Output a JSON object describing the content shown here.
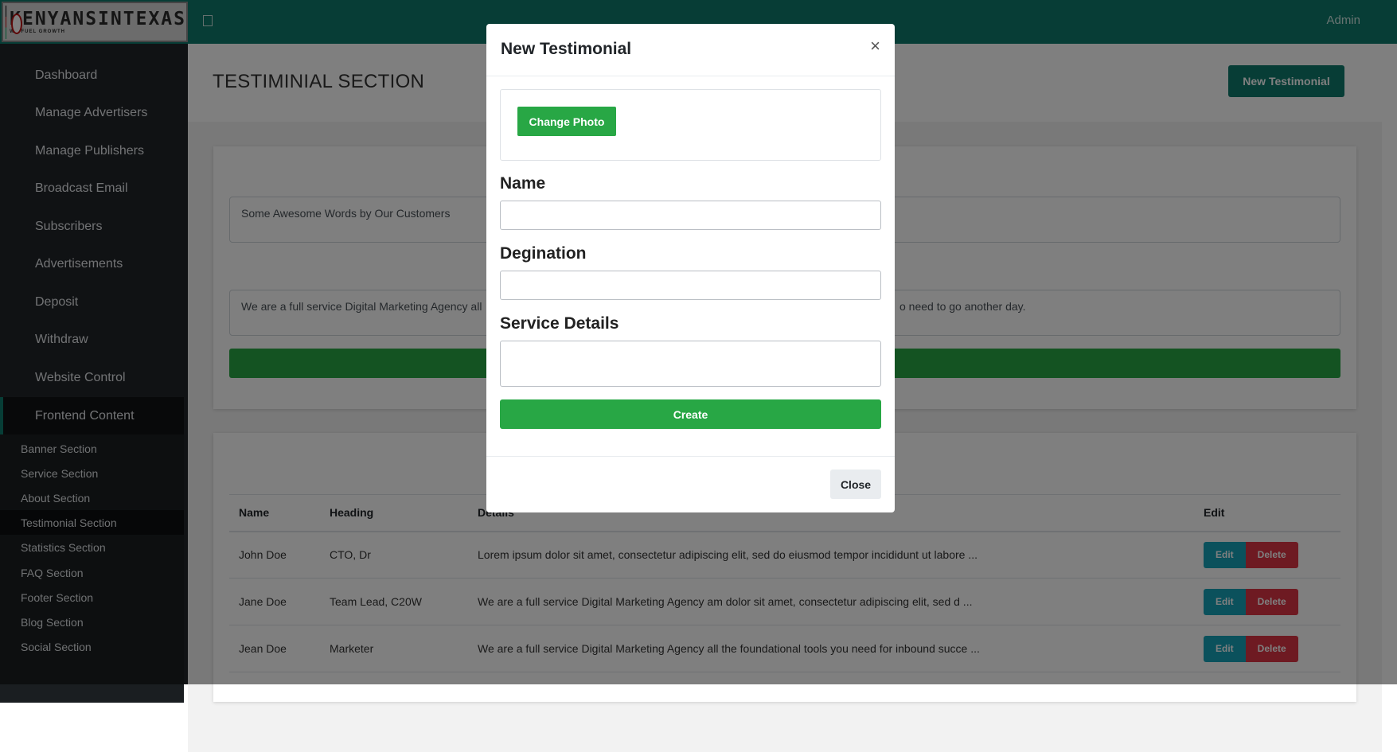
{
  "topbar": {
    "logo_text": "KENYANSINTEXAS",
    "logo_tagline": "WE FUEL GROWTH",
    "user": "Admin"
  },
  "sidebar": {
    "items": [
      {
        "label": "Dashboard"
      },
      {
        "label": "Manage Advertisers"
      },
      {
        "label": "Manage Publishers"
      },
      {
        "label": "Broadcast Email"
      },
      {
        "label": "Subscribers"
      },
      {
        "label": "Advertisements"
      },
      {
        "label": "Deposit"
      },
      {
        "label": "Withdraw"
      },
      {
        "label": "Website Control"
      },
      {
        "label": "Frontend Content"
      }
    ],
    "sub_items": [
      {
        "label": "Banner Section"
      },
      {
        "label": "Service Section"
      },
      {
        "label": "About Section"
      },
      {
        "label": "Testimonial Section"
      },
      {
        "label": "Statistics Section"
      },
      {
        "label": "FAQ Section"
      },
      {
        "label": "Footer Section"
      },
      {
        "label": "Blog Section"
      },
      {
        "label": "Social Section"
      }
    ]
  },
  "main": {
    "title": "TESTIMINIAL SECTION",
    "new_button": "New Testimonial",
    "heading_value": "Some Awesome Words by Our Customers",
    "subheading_left": "We are a full service Digital Marketing Agency all",
    "subheading_right": "o need to go another day."
  },
  "table": {
    "headers": [
      "Name",
      "Heading",
      "Details",
      "Edit"
    ],
    "rows": [
      {
        "name": "John Doe",
        "heading": "CTO, Dr",
        "details": "Lorem ipsum dolor sit amet, consectetur adipiscing elit, sed do eiusmod tempor incididunt ut labore ..."
      },
      {
        "name": "Jane Doe",
        "heading": "Team Lead, C20W",
        "details": "We are a full service Digital Marketing Agency am dolor sit amet, consectetur adipiscing elit, sed d ..."
      },
      {
        "name": "Jean Doe",
        "heading": "Marketer",
        "details": "We are a full service Digital Marketing Agency all the foundational tools you need for inbound succe ..."
      }
    ],
    "edit_label": "Edit",
    "delete_label": "Delete"
  },
  "modal": {
    "title": "New Testimonial",
    "close_x": "×",
    "change_photo": "Change Photo",
    "name_label": "Name",
    "designation_label": "Degination",
    "service_label": "Service Details",
    "create_button": "Create",
    "close_button": "Close"
  }
}
